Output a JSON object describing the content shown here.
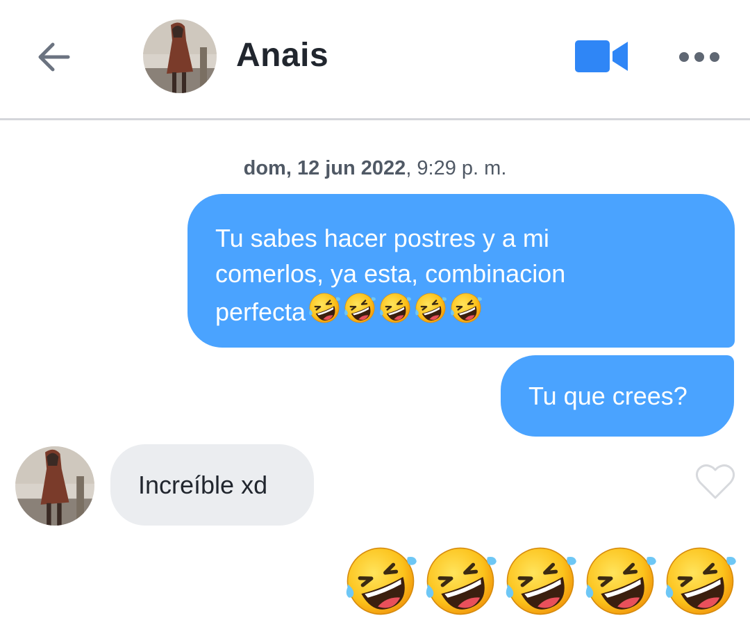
{
  "header": {
    "back_icon": "arrow-left-icon",
    "contact_name": "Anais",
    "video_icon": "video-camera-icon",
    "more_icon": "more-dots-icon"
  },
  "conversation": {
    "timestamp_date": "dom, 12 jun 2022",
    "timestamp_time": ", 9:29 p. m.",
    "messages": [
      {
        "direction": "sent",
        "line1": "Tu sabes hacer postres y a mi",
        "line2": "comerlos, ya esta, combinacion",
        "line3": "perfecta",
        "trailing_emoji": "rolling-on-floor-laughing",
        "trailing_emoji_count": 5
      },
      {
        "direction": "sent",
        "text": "Tu que crees?"
      },
      {
        "direction": "received",
        "text": "Increíble xd",
        "like_icon": "heart-outline-icon"
      },
      {
        "direction": "sent",
        "emoji": "rolling-on-floor-laughing",
        "emoji_count": 5
      }
    ]
  },
  "colors": {
    "sent_bubble": "#4aa3ff",
    "received_bubble": "#ebedf0",
    "accent": "#2f86f6",
    "text": "#21262e"
  }
}
